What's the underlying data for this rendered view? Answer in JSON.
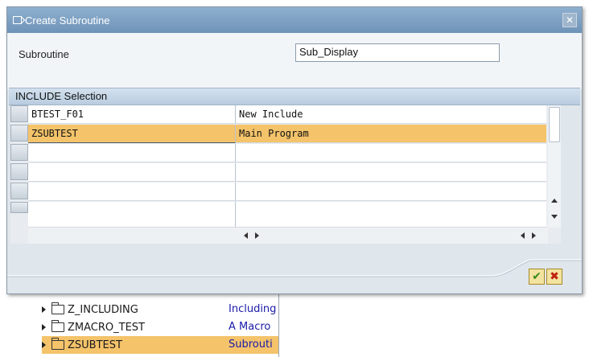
{
  "dialog": {
    "title": "Create Subroutine",
    "close_label": "✕",
    "field_label": "Subroutine",
    "field_value": "Sub_Display"
  },
  "table": {
    "title": "INCLUDE Selection",
    "rows": [
      {
        "name": "BTEST_F01",
        "description": "New Include"
      },
      {
        "name": "ZSUBTEST",
        "description": "Main Program"
      }
    ],
    "selected_row_index": 1
  },
  "buttons": {
    "ok_label": "✔",
    "cancel_label": "✖"
  },
  "background_tree": {
    "items": [
      {
        "name": "Z_INCLUDING",
        "description": "Including"
      },
      {
        "name": "ZMACRO_TEST",
        "description": "A Macro"
      },
      {
        "name": "ZSUBTEST",
        "description": "Subrouti"
      }
    ],
    "selected_index": 2
  },
  "colors": {
    "title_bar": "#7a9ec2",
    "selection": "#f4c36a",
    "dialog_bg": "#dfe6ec"
  }
}
